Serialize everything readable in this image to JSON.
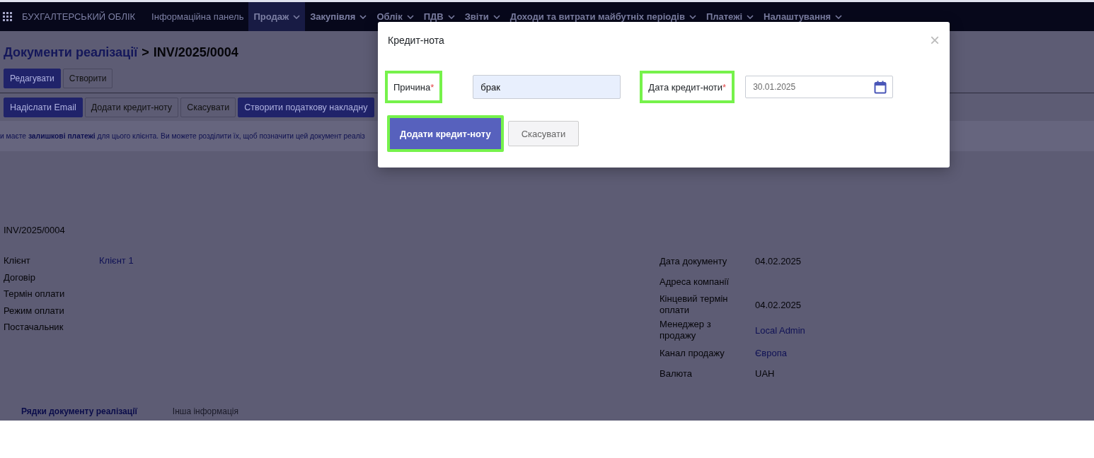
{
  "navbar": {
    "app_title": "БУХГАЛТЕРСЬКИЙ ОБЛІК",
    "menu": [
      {
        "label": "Інформаційна панель",
        "dropdown": false,
        "selected": false
      },
      {
        "label": "Продаж",
        "dropdown": true,
        "selected": true
      },
      {
        "label": "Закупівля",
        "dropdown": true,
        "selected": false
      },
      {
        "label": "Облік",
        "dropdown": true,
        "selected": false
      },
      {
        "label": "ПДВ",
        "dropdown": true,
        "selected": false
      },
      {
        "label": "Звіти",
        "dropdown": true,
        "selected": false
      },
      {
        "label": "Доходи та витрати майбутніх періодів",
        "dropdown": true,
        "selected": false
      },
      {
        "label": "Платежі",
        "dropdown": true,
        "selected": false
      },
      {
        "label": "Налаштування",
        "dropdown": true,
        "selected": false
      }
    ]
  },
  "breadcrumb": {
    "parent": "Документи реалізації",
    "separator": ">",
    "current": "INV/2025/0004"
  },
  "toolbar": [
    {
      "label": "Редагувати",
      "primary": true
    },
    {
      "label": "Створити",
      "primary": false
    }
  ],
  "actions": [
    {
      "label": "Надіслати Email",
      "primary": true
    },
    {
      "label": "Додати кредит-ноту",
      "primary": false
    },
    {
      "label": "Скасувати",
      "primary": false
    },
    {
      "label": "Створити податкову накладну",
      "primary": true
    }
  ],
  "alert": "и маєте **залишкові платежі** для цього клієнта. Ви можете розділити їх, щоб позначити цей документ реаліз",
  "document": {
    "number": "INV/2025/0004",
    "left_fields": [
      {
        "label": "Клієнт",
        "value": "Клієнт 1",
        "link": true
      },
      {
        "label": "Договір"
      },
      {
        "label": "Термін оплати"
      },
      {
        "label": "Режим оплати"
      },
      {
        "label": "Постачальник"
      }
    ],
    "right_fields": [
      {
        "label": "Дата документу",
        "value": "04.02.2025",
        "link": false
      },
      {
        "label": "Адреса компанії"
      },
      {
        "label": "Кінцевий термін оплати",
        "value": "04.02.2025",
        "link": false
      },
      {
        "label": "Менеджер з продажу",
        "value": "Local Admin",
        "link": true
      },
      {
        "label": "Канал продажу",
        "value": "Європа",
        "link": true
      },
      {
        "label": "Валюта",
        "value": "UAH",
        "link": false
      }
    ],
    "tabs": [
      {
        "label": "Рядки документу реалізації",
        "selected": true
      },
      {
        "label": "Інша інформація",
        "selected": false
      }
    ]
  },
  "dialog": {
    "title": "Кредит-нота",
    "close": "×",
    "fields": [
      {
        "label": "Причина",
        "asterisk": "*",
        "highlighted": true,
        "value": "брак",
        "kind": "text"
      },
      {
        "label": "Дата кредит-ноти",
        "asterisk": "*",
        "highlighted": true,
        "value": "30.01.2025",
        "kind": "date"
      }
    ],
    "buttons": [
      {
        "label": "Додати кредит-ноту",
        "primary": true,
        "highlighted": true
      },
      {
        "label": "Скасувати",
        "primary": false,
        "highlighted": false
      }
    ]
  }
}
